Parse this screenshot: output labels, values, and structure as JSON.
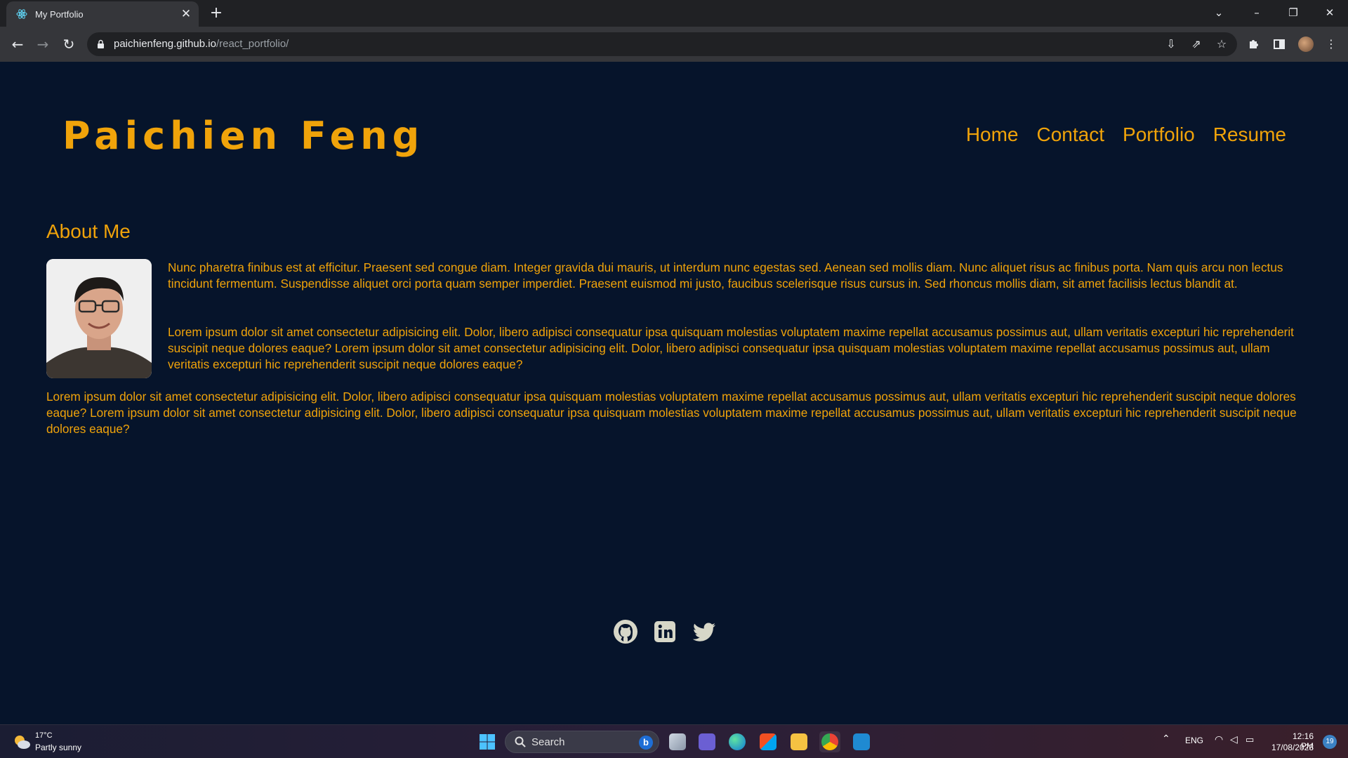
{
  "browser": {
    "tab_title": "My Portfolio",
    "tab_close": "✕",
    "new_tab": "+",
    "url_host": "paichienfeng.github.io",
    "url_path": "/react_portfolio/"
  },
  "site": {
    "title": "Paichien Feng",
    "nav": [
      "Home",
      "Contact",
      "Portfolio",
      "Resume"
    ]
  },
  "about": {
    "heading": "About Me",
    "paragraphs": [
      "Nunc pharetra finibus est at efficitur. Praesent sed congue diam. Integer gravida dui mauris, ut interdum nunc egestas sed. Aenean sed mollis diam. Nunc aliquet risus ac finibus porta. Nam quis arcu non lectus tincidunt fermentum. Suspendisse aliquet orci porta quam semper imperdiet. Praesent euismod mi justo, faucibus scelerisque risus cursus in. Sed rhoncus mollis diam, sit amet facilisis lectus blandit at.",
      "Lorem ipsum dolor sit amet consectetur adipisicing elit. Dolor, libero adipisci consequatur ipsa quisquam molestias voluptatem maxime repellat accusamus possimus aut, ullam veritatis excepturi hic reprehenderit suscipit neque dolores eaque? Lorem ipsum dolor sit amet consectetur adipisicing elit. Dolor, libero adipisci consequatur ipsa quisquam molestias voluptatem maxime repellat accusamus possimus aut, ullam veritatis excepturi hic reprehenderit suscipit neque dolores eaque?",
      "Lorem ipsum dolor sit amet consectetur adipisicing elit. Dolor, libero adipisci consequatur ipsa quisquam molestias voluptatem maxime repellat accusamus possimus aut, ullam veritatis excepturi hic reprehenderit suscipit neque dolores eaque? Lorem ipsum dolor sit amet consectetur adipisicing elit. Dolor, libero adipisci consequatur ipsa quisquam molestias voluptatem maxime repellat accusamus possimus aut, ullam veritatis excepturi hic reprehenderit suscipit neque dolores eaque?"
    ]
  },
  "socials": [
    "github-icon",
    "linkedin-icon",
    "twitter-icon"
  ],
  "taskbar": {
    "weather_temp": "17°C",
    "weather_desc": "Partly sunny",
    "search_label": "Search",
    "tray_lang": "ENG",
    "clock_time": "12:16 PM",
    "clock_date": "17/08/2023",
    "notification_count": "19"
  },
  "colors": {
    "accent": "#f0a30a",
    "page_bg": "#06142b",
    "icon_gray": "#d7d7c8"
  }
}
